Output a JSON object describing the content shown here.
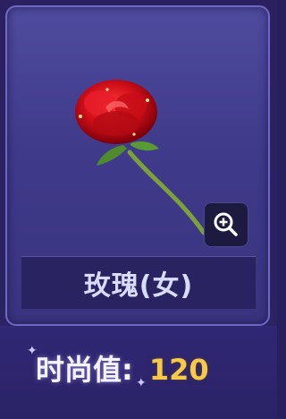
{
  "item": {
    "name": "玫瑰(女)",
    "icon": "rose-icon",
    "zoom_icon": "zoom-in-icon"
  },
  "fashion": {
    "label": "时尚值:",
    "value": "120"
  },
  "colors": {
    "card_bg": "#4f4b9e",
    "name_bar": "#2a2362",
    "value_gold": "#f7c94a"
  }
}
